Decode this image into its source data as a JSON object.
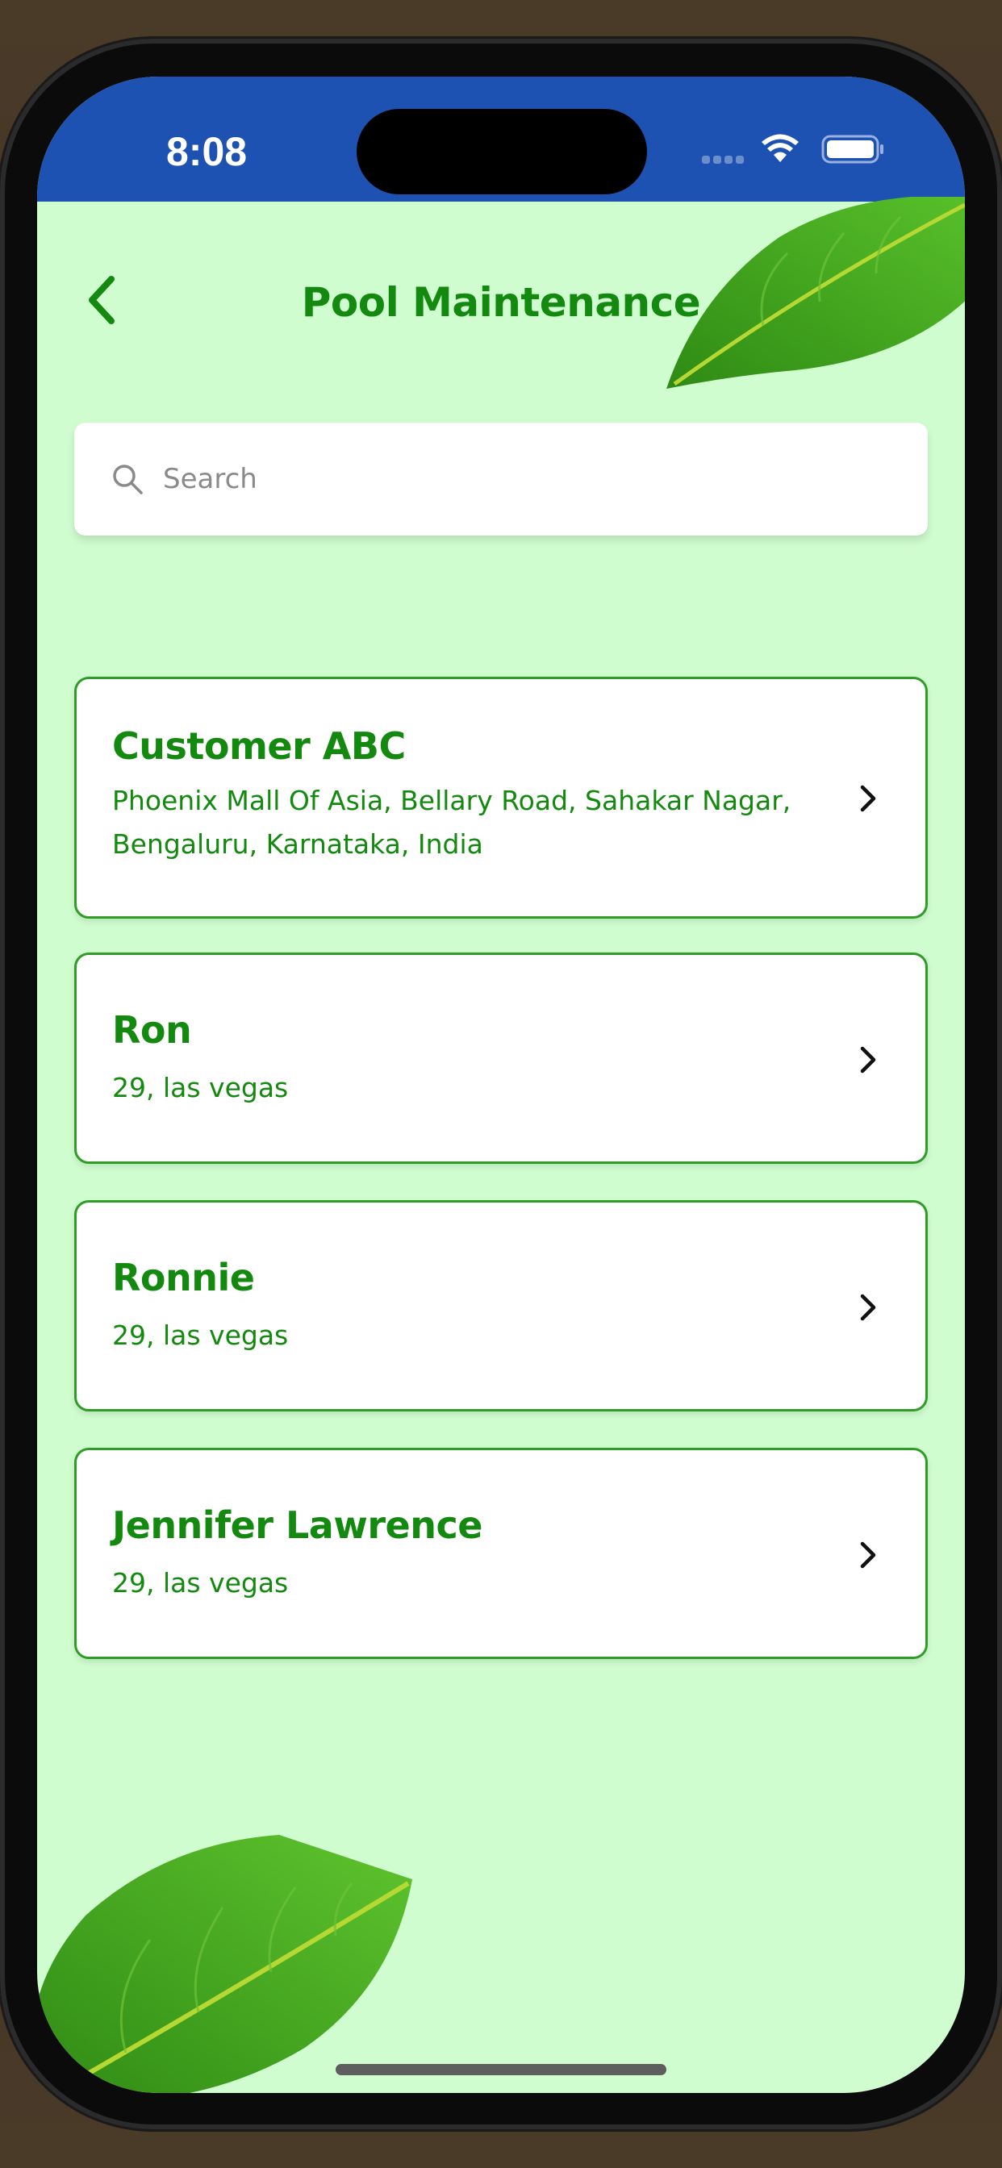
{
  "status_bar": {
    "time": "8:08"
  },
  "header": {
    "title": "Pool Maintenance"
  },
  "search": {
    "placeholder": "Search"
  },
  "customers": [
    {
      "name": "Customer ABC",
      "address_line1": "Phoenix Mall Of Asia, Bellary Road, Sahakar Nagar,",
      "address_line2": "Bengaluru, Karnataka, India"
    },
    {
      "name": "Ron",
      "address_line1": "29, las vegas"
    },
    {
      "name": "Ronnie",
      "address_line1": "29, las vegas"
    },
    {
      "name": "Jennifer Lawrence",
      "address_line1": "29, las vegas"
    }
  ],
  "colors": {
    "status_bar": "#1e52b2",
    "background": "#d0fdd0",
    "accent": "#14890f",
    "card_border": "#2e9c25"
  }
}
